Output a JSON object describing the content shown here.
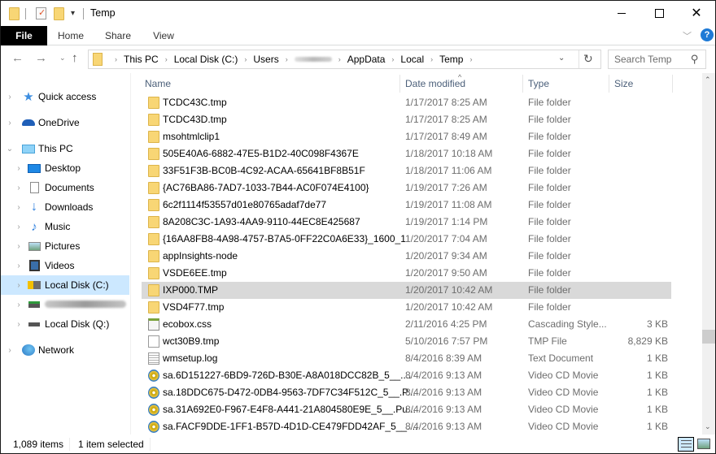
{
  "window": {
    "title": "Temp",
    "controls": {
      "minimize": "minimize",
      "maximize": "maximize",
      "close": "close"
    }
  },
  "ribbon": {
    "tabs": [
      {
        "label": "File",
        "active": true
      },
      {
        "label": "Home"
      },
      {
        "label": "Share"
      },
      {
        "label": "View"
      }
    ],
    "help_glyph": "?"
  },
  "navbar": {
    "breadcrumbs": [
      "This PC",
      "Local Disk (C:)",
      "Users",
      "[redacted]",
      "AppData",
      "Local",
      "Temp"
    ],
    "search_placeholder": "Search Temp"
  },
  "sidebar": {
    "items": [
      {
        "label": "Quick access",
        "icon": "star-icon",
        "expanded": false,
        "level": 0
      },
      {
        "label": "OneDrive",
        "icon": "cloud-icon",
        "expanded": false,
        "level": 0
      },
      {
        "label": "This PC",
        "icon": "computer-icon",
        "expanded": true,
        "level": 0
      },
      {
        "label": "Desktop",
        "icon": "desktop-icon",
        "level": 1
      },
      {
        "label": "Documents",
        "icon": "documents-icon",
        "level": 1
      },
      {
        "label": "Downloads",
        "icon": "downloads-icon",
        "level": 1
      },
      {
        "label": "Music",
        "icon": "music-icon",
        "level": 1
      },
      {
        "label": "Pictures",
        "icon": "pictures-icon",
        "level": 1
      },
      {
        "label": "Videos",
        "icon": "videos-icon",
        "level": 1
      },
      {
        "label": "Local Disk (C:)",
        "icon": "disk-warning-icon",
        "level": 1,
        "selected": true
      },
      {
        "label": "[redacted]",
        "icon": "network-drive-icon",
        "level": 1,
        "redacted": true
      },
      {
        "label": "Local Disk (Q:)",
        "icon": "disk-icon",
        "level": 1
      },
      {
        "label": "Network",
        "icon": "network-icon",
        "level": 0
      }
    ]
  },
  "filelist": {
    "columns": {
      "name": "Name",
      "date": "Date modified",
      "type": "Type",
      "size": "Size"
    },
    "sort_column": "date",
    "rows": [
      {
        "name": "TCDC43C.tmp",
        "date": "1/17/2017 8:25 AM",
        "type": "File folder",
        "size": "",
        "icon": "folder"
      },
      {
        "name": "TCDC43D.tmp",
        "date": "1/17/2017 8:25 AM",
        "type": "File folder",
        "size": "",
        "icon": "folder"
      },
      {
        "name": "msohtmlclip1",
        "date": "1/17/2017 8:49 AM",
        "type": "File folder",
        "size": "",
        "icon": "folder"
      },
      {
        "name": "505E40A6-6882-47E5-B1D2-40C098F4367E",
        "date": "1/18/2017 10:18 AM",
        "type": "File folder",
        "size": "",
        "icon": "folder"
      },
      {
        "name": "33F51F3B-BC0B-4C92-ACAA-65641BF8B51F",
        "date": "1/18/2017 11:06 AM",
        "type": "File folder",
        "size": "",
        "icon": "folder"
      },
      {
        "name": "{AC76BA86-7AD7-1033-7B44-AC0F074E4100}",
        "date": "1/19/2017 7:26 AM",
        "type": "File folder",
        "size": "",
        "icon": "folder"
      },
      {
        "name": "6c2f1114f53557d01e80765adaf7de77",
        "date": "1/19/2017 11:08 AM",
        "type": "File folder",
        "size": "",
        "icon": "folder"
      },
      {
        "name": "8A208C3C-1A93-4AA9-9110-44EC8E425687",
        "date": "1/19/2017 1:14 PM",
        "type": "File folder",
        "size": "",
        "icon": "folder"
      },
      {
        "name": "{16AA8FB8-4A98-4757-B7A5-0FF22C0A6E33}_1600_1",
        "date": "1/20/2017 7:04 AM",
        "type": "File folder",
        "size": "",
        "icon": "folder"
      },
      {
        "name": "appInsights-node",
        "date": "1/20/2017 9:34 AM",
        "type": "File folder",
        "size": "",
        "icon": "folder"
      },
      {
        "name": "VSDE6EE.tmp",
        "date": "1/20/2017 9:50 AM",
        "type": "File folder",
        "size": "",
        "icon": "folder"
      },
      {
        "name": "IXP000.TMP",
        "date": "1/20/2017 10:42 AM",
        "type": "File folder",
        "size": "",
        "icon": "folder",
        "selected": true
      },
      {
        "name": "VSD4F77.tmp",
        "date": "1/20/2017 10:42 AM",
        "type": "File folder",
        "size": "",
        "icon": "folder"
      },
      {
        "name": "ecobox.css",
        "date": "2/11/2016 4:25 PM",
        "type": "Cascading Style...",
        "size": "3 KB",
        "icon": "css"
      },
      {
        "name": "wct30B9.tmp",
        "date": "5/10/2016 7:57 PM",
        "type": "TMP File",
        "size": "8,829 KB",
        "icon": "file"
      },
      {
        "name": "wmsetup.log",
        "date": "8/4/2016 8:39 AM",
        "type": "Text Document",
        "size": "1 KB",
        "icon": "text"
      },
      {
        "name": "sa.6D151227-6BD9-726D-B30E-A8A018DCC82B_5__....",
        "date": "8/4/2016 9:13 AM",
        "type": "Video CD Movie",
        "size": "1 KB",
        "icon": "disc"
      },
      {
        "name": "sa.18DDC675-D472-0DB4-9563-7DF7C34F512C_5__.P...",
        "date": "8/4/2016 9:13 AM",
        "type": "Video CD Movie",
        "size": "1 KB",
        "icon": "disc"
      },
      {
        "name": "sa.31A692E0-F967-E4F8-A441-21A804580E9E_5__.Pu...",
        "date": "8/4/2016 9:13 AM",
        "type": "Video CD Movie",
        "size": "1 KB",
        "icon": "disc"
      },
      {
        "name": "sa.FACF9DDE-1FF1-B57D-4D1D-CE479FDD42AF_5__....",
        "date": "8/4/2016 9:13 AM",
        "type": "Video CD Movie",
        "size": "1 KB",
        "icon": "disc"
      }
    ]
  },
  "statusbar": {
    "item_count": "1,089 items",
    "selection": "1 item selected"
  },
  "colors": {
    "selected_nav_bg": "#cce8ff",
    "selected_row_bg": "#d9d9d9",
    "file_tab_bg": "#000000",
    "folder_yellow": "#f8d675",
    "header_text": "#4c607a"
  }
}
